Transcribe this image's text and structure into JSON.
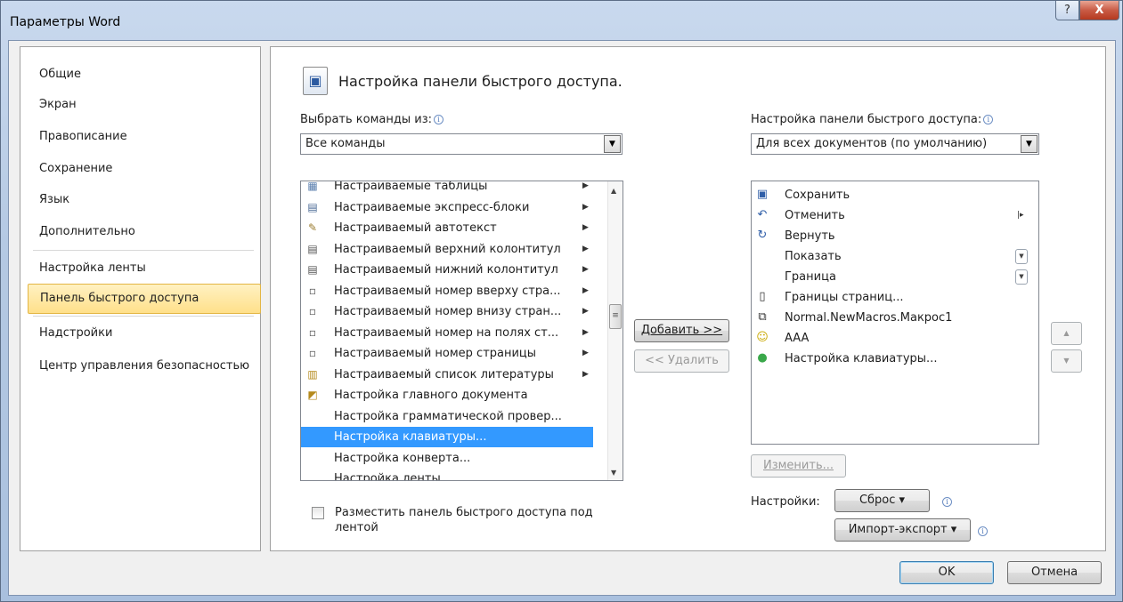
{
  "window": {
    "title": "Параметры Word",
    "help_glyph": "?",
    "close_glyph": "X"
  },
  "nav": {
    "items": [
      {
        "label": "Общие"
      },
      {
        "label": "Экран"
      },
      {
        "label": "Правописание"
      },
      {
        "label": "Сохранение"
      },
      {
        "label": "Язык"
      },
      {
        "label": "Дополнительно"
      },
      {
        "label": "Настройка ленты"
      },
      {
        "label": "Панель быстрого доступа"
      },
      {
        "label": "Надстройки"
      },
      {
        "label": "Центр управления безопасностью"
      }
    ],
    "selected_index": 7
  },
  "main": {
    "heading": "Настройка панели быстрого доступа.",
    "choose_label": "Выбрать команды из:",
    "choose_value": "Все команды",
    "customize_label": "Настройка панели быстрого доступа:",
    "customize_value": "Для всех документов (по умолчанию)",
    "info_glyph": "i",
    "commands": [
      {
        "label": "Настраиваемые таблицы",
        "icon": "table-icon",
        "submenu": true
      },
      {
        "label": "Настраиваемые экспресс-блоки",
        "icon": "quick-parts-icon",
        "submenu": true
      },
      {
        "label": "Настраиваемый автотекст",
        "icon": "autotext-icon",
        "submenu": true
      },
      {
        "label": "Настраиваемый верхний колонтитул",
        "icon": "header-icon",
        "submenu": true
      },
      {
        "label": "Настраиваемый нижний колонтитул",
        "icon": "footer-icon",
        "submenu": true
      },
      {
        "label": "Настраиваемый номер вверху стра...",
        "icon": "page-number-top-icon",
        "submenu": true
      },
      {
        "label": "Настраиваемый номер внизу стран...",
        "icon": "page-number-bottom-icon",
        "submenu": true
      },
      {
        "label": "Настраиваемый номер на полях ст...",
        "icon": "page-number-margin-icon",
        "submenu": true
      },
      {
        "label": "Настраиваемый номер страницы",
        "icon": "page-number-icon",
        "submenu": true
      },
      {
        "label": "Настраиваемый список литературы",
        "icon": "bibliography-icon",
        "submenu": true
      },
      {
        "label": "Настройка главного документа",
        "icon": "master-document-icon",
        "submenu": false
      },
      {
        "label": "Настройка грамматической провер...",
        "icon": "",
        "submenu": false
      },
      {
        "label": "Настройка клавиатуры...",
        "icon": "",
        "submenu": false
      },
      {
        "label": "Настройка конверта...",
        "icon": "",
        "submenu": false
      },
      {
        "label": "Настройка ленты...",
        "icon": "",
        "submenu": false
      }
    ],
    "selected_command_index": 12,
    "add_button": "Добавить >>",
    "remove_button": "<< Удалить",
    "toolbar_items": [
      {
        "label": "Сохранить",
        "icon": "save-icon",
        "extra": ""
      },
      {
        "label": "Отменить",
        "icon": "undo-icon",
        "extra": "separator-arrow"
      },
      {
        "label": "Вернуть",
        "icon": "redo-icon",
        "extra": ""
      },
      {
        "label": "Показать",
        "icon": "",
        "extra": "dropdown"
      },
      {
        "label": "Граница",
        "icon": "",
        "extra": "dropdown"
      },
      {
        "label": "Границы страниц...",
        "icon": "page-borders-icon",
        "extra": ""
      },
      {
        "label": "Normal.NewMacros.Макрос1",
        "icon": "macro-icon",
        "extra": ""
      },
      {
        "label": "AAA",
        "icon": "smiley-icon",
        "extra": ""
      },
      {
        "label": "Настройка клавиатуры...",
        "icon": "keyboard-settings-icon",
        "extra": ""
      }
    ],
    "modify_button": "Изменить...",
    "settings_label": "Настройки:",
    "reset_button": "Сброс ▾",
    "import_export_button": "Импорт-экспорт ▾",
    "show_below_label": "Разместить панель быстрого доступа под лентой",
    "show_below_checked": false
  },
  "footer": {
    "ok": "OK",
    "cancel": "Отмена"
  }
}
